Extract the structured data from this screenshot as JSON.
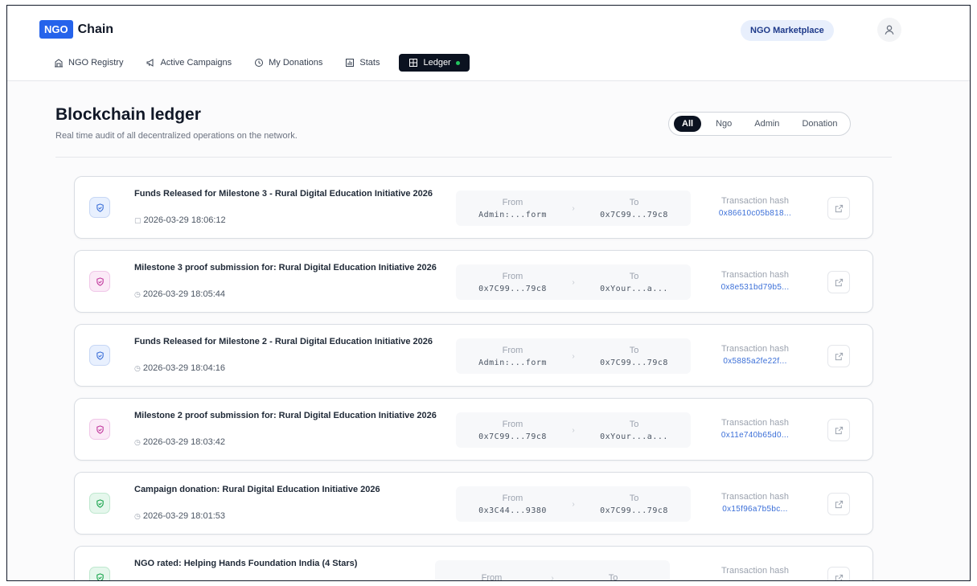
{
  "brand": {
    "badge": "NGO",
    "name": "Chain"
  },
  "header": {
    "marketplace_label": "NGO Marketplace"
  },
  "nav": [
    {
      "label": "NGO Registry",
      "icon": "building-icon"
    },
    {
      "label": "Active Campaigns",
      "icon": "megaphone-icon"
    },
    {
      "label": "My Donations",
      "icon": "history-icon"
    },
    {
      "label": "Stats",
      "icon": "chart-icon"
    },
    {
      "label": "Ledger",
      "icon": "grid-icon",
      "active": true
    }
  ],
  "page": {
    "title": "Blockchain ledger",
    "subtitle": "Real time audit of all decentralized operations on the network."
  },
  "filters": [
    "All",
    "Ngo",
    "Admin",
    "Donation"
  ],
  "labels": {
    "from": "From",
    "to": "To",
    "hash": "Transaction hash"
  },
  "transactions": [
    {
      "title": "Funds Released for Milestone 3 - Rural Digital Education Initiative 2026",
      "time": "2026-03-29 18:06:12",
      "from": "Admin:...form",
      "to": "0x7C99...79c8",
      "hash": "0x86610c05b818...",
      "tone": "blue"
    },
    {
      "title": "Milestone 3 proof submission for: Rural Digital Education Initiative 2026",
      "time": "2026-03-29 18:05:44",
      "from": "0x7C99...79c8",
      "to": "0xYour...a...",
      "hash": "0x8e531bd79b5...",
      "tone": "pink"
    },
    {
      "title": "Funds Released for Milestone 2 - Rural Digital Education Initiative 2026",
      "time": "2026-03-29 18:04:16",
      "from": "Admin:...form",
      "to": "0x7C99...79c8",
      "hash": "0x5885a2fe22f...",
      "tone": "blue"
    },
    {
      "title": "Milestone 2 proof submission for: Rural Digital Education Initiative 2026",
      "time": "2026-03-29 18:03:42",
      "from": "0x7C99...79c8",
      "to": "0xYour...a...",
      "hash": "0x11e740b65d0...",
      "tone": "pink"
    },
    {
      "title": "Campaign donation: Rural Digital Education Initiative 2026",
      "time": "2026-03-29 18:01:53",
      "from": "0x3C44...9380",
      "to": "0x7C99...79c8",
      "hash": "0x15f96a7b5bc...",
      "tone": "green"
    },
    {
      "title": "NGO rated: Helping Hands Foundation India (4 Stars)",
      "time": "",
      "from": "",
      "to": "",
      "hash": "",
      "tone": "green"
    }
  ]
}
